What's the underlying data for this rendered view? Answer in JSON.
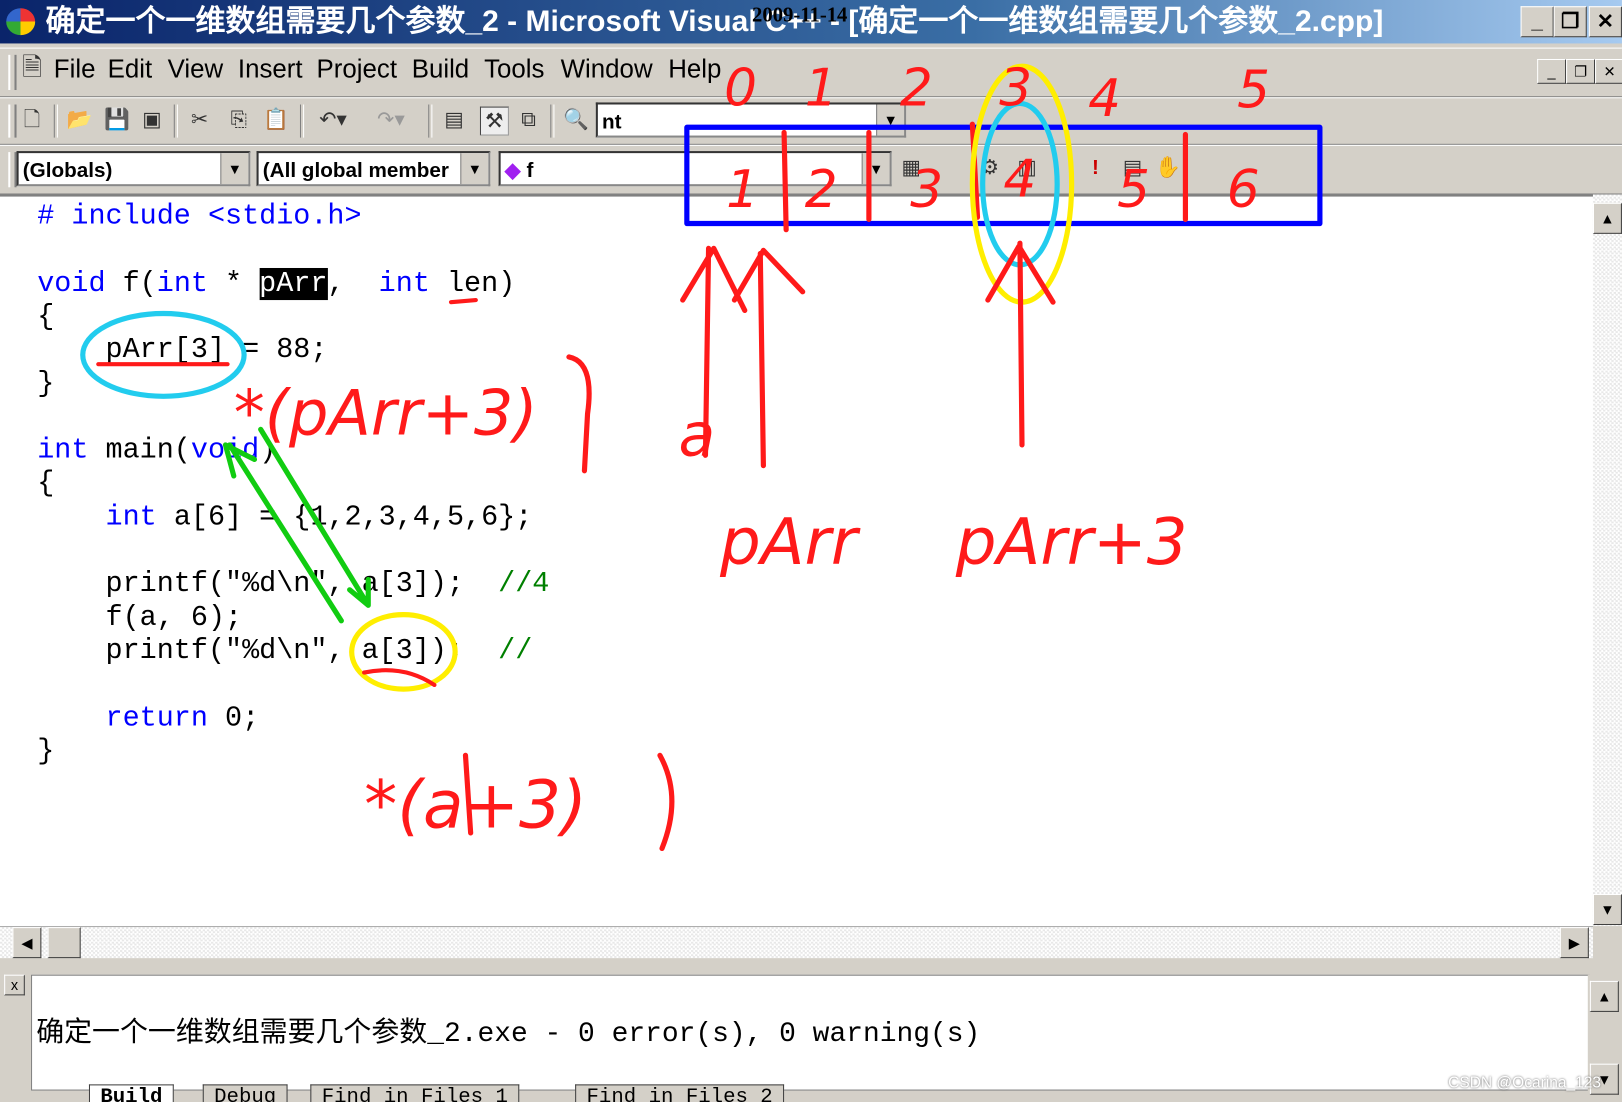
{
  "window": {
    "title": "确定一个一维数组需要几个参数_2 - Microsoft Visual C++ - [确定一个一维数组需要几个参数_2.cpp]",
    "date_overlay": "2009-11-14",
    "buttons": {
      "minimize": "_",
      "restore": "❐",
      "close": "✕"
    }
  },
  "menu": [
    {
      "label": "File",
      "key": "F"
    },
    {
      "label": "Edit",
      "key": "E"
    },
    {
      "label": "View",
      "key": "V"
    },
    {
      "label": "Insert",
      "key": "I"
    },
    {
      "label": "Project",
      "key": "P"
    },
    {
      "label": "Build",
      "key": "B"
    },
    {
      "label": "Tools",
      "key": "T"
    },
    {
      "label": "Window",
      "key": "W"
    },
    {
      "label": "Help",
      "key": "H"
    }
  ],
  "toolbar": {
    "find_combo_value": "nt"
  },
  "wizardbar": {
    "class_combo": "(Globals)",
    "filter_combo": "(All global member",
    "member_combo": "f"
  },
  "editor": {
    "lines": [
      [
        [
          "# include <stdio.h>",
          "kw-inc"
        ]
      ],
      [],
      [
        [
          "void",
          "kw"
        ],
        [
          " f(",
          ""
        ],
        [
          "int",
          "kw"
        ],
        [
          " * ",
          ""
        ],
        [
          "pArr",
          "sel"
        ],
        [
          ",  ",
          ""
        ],
        [
          "int",
          "kw"
        ],
        [
          " len)",
          ""
        ]
      ],
      [
        [
          "{",
          ""
        ]
      ],
      [
        [
          "    pArr[3] = 88;",
          ""
        ]
      ],
      [
        [
          "}",
          ""
        ]
      ],
      [],
      [
        [
          "int",
          "kw"
        ],
        [
          " main(",
          ""
        ],
        [
          "void",
          "kw"
        ],
        [
          ")",
          ""
        ]
      ],
      [
        [
          "{",
          ""
        ]
      ],
      [
        [
          "    ",
          ""
        ],
        [
          "int",
          "kw"
        ],
        [
          " a[6] = {1,2,3,4,5,6};",
          ""
        ]
      ],
      [],
      [
        [
          "    printf(\"%d\\n\", a[3]);  ",
          ""
        ],
        [
          "//4",
          "cm"
        ]
      ],
      [
        [
          "    f(a, 6);",
          ""
        ]
      ],
      [
        [
          "    printf(\"%d\\n\", a[3]);  ",
          ""
        ],
        [
          "//",
          "cm"
        ]
      ],
      [],
      [
        [
          "    ",
          ""
        ],
        [
          "return",
          "kw"
        ],
        [
          " 0;",
          ""
        ]
      ],
      [
        [
          "}",
          ""
        ]
      ]
    ]
  },
  "annotations": {
    "index_labels": [
      "0",
      "1",
      "2",
      "3",
      "4",
      "5"
    ],
    "element_values": [
      "1",
      "2",
      "3",
      "4",
      "5",
      "6"
    ],
    "a_label": "a",
    "parr_label": "pArr",
    "parr3_label": "pArr+3",
    "deref_parr": "*(pArr+3)",
    "deref_a": "*(a+3)",
    "colors": {
      "ink": "#ff1a1a",
      "box": "#0000ff",
      "cyan": "#22ccee",
      "yellow": "#ffee00",
      "green": "#11cc11"
    }
  },
  "output": {
    "text": "确定一个一维数组需要几个参数_2.exe - 0 error(s), 0 warning(s)",
    "tabs": [
      "Build",
      "Debug",
      "Find in Files 1",
      "Find in Files 2"
    ]
  },
  "watermark": "CSDN @Ocarina_123"
}
